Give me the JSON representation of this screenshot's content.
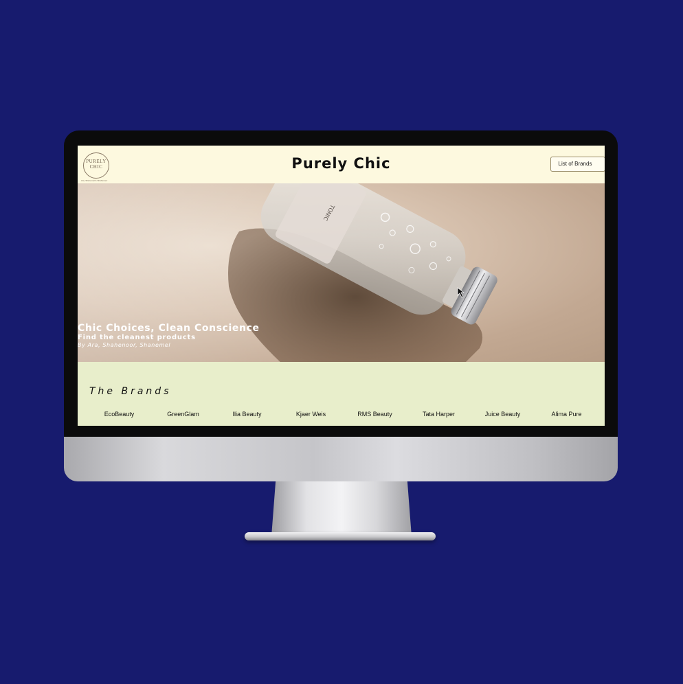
{
  "header": {
    "logo_text": "PURELY\nCHIC",
    "logo_tagline": "Ara, Shanemel & Shahenoor",
    "title": "Purely Chic",
    "list_of_brands_label": "List of Brands"
  },
  "hero": {
    "heading": "Chic Choices, Clean Conscience",
    "subheading": "Find the cleanest products",
    "authors": "By Ara, Shahenoor, Shanemel",
    "bottle_label": "TONIC"
  },
  "brands": {
    "heading": "The Brands",
    "items": [
      "EcoBeauty",
      "GreenGlam",
      "Ilia Beauty",
      "Kjaer Weis",
      "RMS Beauty",
      "Tata Harper",
      "Juice Beauty",
      "Alima Pure"
    ]
  },
  "colors": {
    "backdrop": "#171b6e",
    "header_bg": "#fdf9df",
    "brands_bg": "#e8eecb",
    "hero_bg": "#d9c4b1"
  },
  "icons": {
    "cursor": "mouse-cursor-icon"
  }
}
